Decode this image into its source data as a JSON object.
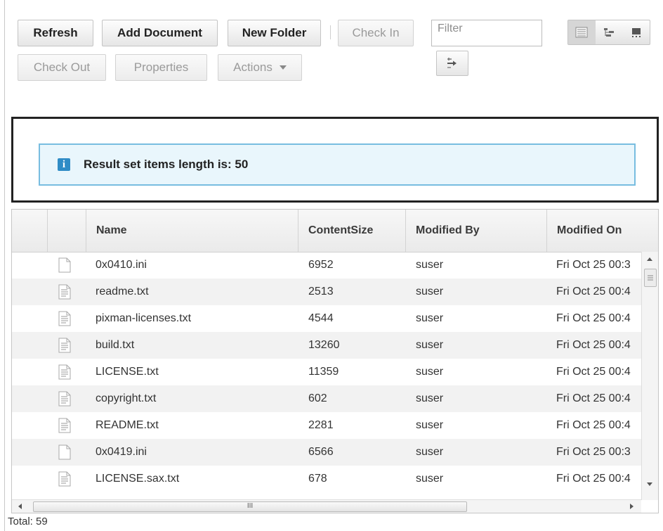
{
  "toolbar": {
    "refresh": "Refresh",
    "add_document": "Add Document",
    "new_folder": "New Folder",
    "check_in": "Check In",
    "check_out": "Check Out",
    "properties": "Properties",
    "actions": "Actions"
  },
  "filter": {
    "placeholder": "Filter",
    "value": ""
  },
  "message": {
    "text": "Result set items length is: 50"
  },
  "grid": {
    "columns": [
      "Name",
      "ContentSize",
      "Modified By",
      "Modified On"
    ],
    "rows": [
      {
        "icon": "blank-file-icon",
        "name": "0x0410.ini",
        "size": "6952",
        "modified_by": "suser",
        "modified_on": "Fri Oct 25 00:3"
      },
      {
        "icon": "text-file-icon",
        "name": "readme.txt",
        "size": "2513",
        "modified_by": "suser",
        "modified_on": "Fri Oct 25 00:4"
      },
      {
        "icon": "text-file-icon",
        "name": "pixman-licenses.txt",
        "size": "4544",
        "modified_by": "suser",
        "modified_on": "Fri Oct 25 00:4"
      },
      {
        "icon": "text-file-icon",
        "name": "build.txt",
        "size": "13260",
        "modified_by": "suser",
        "modified_on": "Fri Oct 25 00:4"
      },
      {
        "icon": "text-file-icon",
        "name": "LICENSE.txt",
        "size": "11359",
        "modified_by": "suser",
        "modified_on": "Fri Oct 25 00:4"
      },
      {
        "icon": "text-file-icon",
        "name": "copyright.txt",
        "size": "602",
        "modified_by": "suser",
        "modified_on": "Fri Oct 25 00:4"
      },
      {
        "icon": "text-file-icon",
        "name": "README.txt",
        "size": "2281",
        "modified_by": "suser",
        "modified_on": "Fri Oct 25 00:4"
      },
      {
        "icon": "blank-file-icon",
        "name": "0x0419.ini",
        "size": "6566",
        "modified_by": "suser",
        "modified_on": "Fri Oct 25 00:3"
      },
      {
        "icon": "text-file-icon",
        "name": "LICENSE.sax.txt",
        "size": "678",
        "modified_by": "suser",
        "modified_on": "Fri Oct 25 00:4"
      }
    ]
  },
  "scrollbar": {
    "thumb_label": "III"
  },
  "footer": {
    "total": "Total: 59"
  },
  "colors": {
    "info_border": "#78bde0",
    "info_bg": "#e9f6fc",
    "info_icon": "#2f8cc6"
  }
}
